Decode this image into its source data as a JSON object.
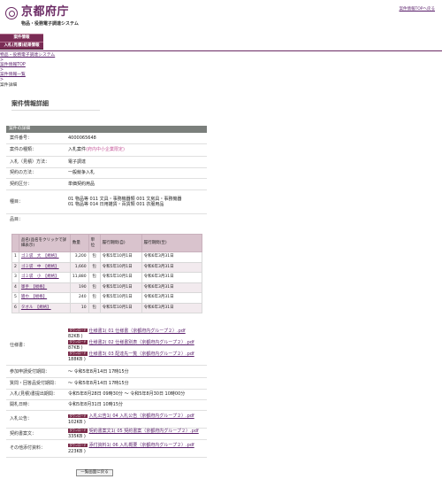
{
  "header": {
    "logo_title": "京都府庁",
    "logo_sub": "物品・役務電子調達システム",
    "help_link": "案件情報TOPへ戻る"
  },
  "nav": {
    "items": [
      "案件情報",
      "入札(見積)結果情報"
    ]
  },
  "breadcrumb": {
    "items": [
      "物品・役務電子調達システム",
      "案件情報TOP",
      "案件情報一覧"
    ],
    "separator": ">",
    "current": "案件詳細"
  },
  "page_title": "案件情報詳細",
  "section_title": "案件の詳細",
  "fields": {
    "case_no": {
      "label": "案件番号：",
      "value": "4000065648"
    },
    "case_type": {
      "label": "案件の種類：",
      "value": "入札案件",
      "note": "(府内中小企業限定)"
    },
    "bid_method": {
      "label": "入札（見積）方法：",
      "value": "電子調達"
    },
    "contract_method": {
      "label": "契約の方法：",
      "value": "一般競争入札"
    },
    "contract_class": {
      "label": "契約区分：",
      "value": "単価契約用品"
    },
    "category": {
      "label": "種目：",
      "lines": [
        "01 物品等 011 文具・事務機器類 001 文房具・事務機器",
        "01 物品等 014 日用雑貨・百貨類 001 衣服用品"
      ]
    },
    "items_label": "品目："
  },
  "items_table": {
    "headers": [
      "",
      "品名(品名をクリックで詳細表示)",
      "数量",
      "単位",
      "履行期間(自)",
      "履行期間(至)"
    ],
    "rows": [
      [
        "1",
        "ゴミ袋　大　【規格】",
        "3,200",
        "包",
        "令和5年10月1日",
        "令和6年3月31日"
      ],
      [
        "2",
        "ゴミ袋　中　【規格】",
        "1,660",
        "包",
        "令和5年10月1日",
        "令和6年3月31日"
      ],
      [
        "3",
        "ゴミ袋　小　【規格】",
        "11,880",
        "包",
        "令和5年10月1日",
        "令和6年3月31日"
      ],
      [
        "4",
        "軍手　【規格】",
        "190",
        "包",
        "令和5年10月1日",
        "令和6年3月31日"
      ],
      [
        "5",
        "雑巾　【規格】",
        "240",
        "包",
        "令和5年10月1日",
        "令和6年3月31日"
      ],
      [
        "6",
        "タオル　【規格】",
        "10",
        "包",
        "令和5年10月1日",
        "令和6年3月31日"
      ]
    ]
  },
  "download_badge": "ダウンロード",
  "spec": {
    "label": "仕様書：",
    "docs": [
      {
        "name": "仕様書1( 01 仕様書（京都府内グループ２）.pdf",
        "size": "82KB )"
      },
      {
        "name": "仕様書2( 02 仕様書別表（京都府内グループ２）.pdf",
        "size": "87KB )"
      },
      {
        "name": "仕様書3( 03 配達先一覧（京都府内グループ２）.pdf",
        "size": "188KB )"
      }
    ]
  },
  "schedule": {
    "participation": {
      "label": "参加申請受付期間：",
      "value": "～ 令和5年8月14日 17時15分"
    },
    "questions": {
      "label": "質問・回答品受付期間：",
      "value": "～ 令和5年8月14日 17時15分"
    },
    "bid_period": {
      "label": "入札(見積)書提出期間：",
      "value": "令和5年8月28日 09時30分 ～ 令和5年8月30日 10時00分"
    },
    "opening": {
      "label": "開札日時：",
      "value": "令和5年8月31日 10時15分"
    }
  },
  "notice": {
    "label": "入札公告：",
    "docs": [
      {
        "name": "入札公告1( 04 入札公告（京都府内グループ２）.pdf",
        "size": "102KB )"
      }
    ]
  },
  "contract_draft": {
    "label": "契約書案文：",
    "docs": [
      {
        "name": "契約書案文1( 05 契約書案（京都府内グループ２）.pdf",
        "size": "335KB )"
      }
    ]
  },
  "other": {
    "label": "その他添付資料：",
    "docs": [
      {
        "name": "添付資料1( 06 入札概要（京都府内グループ２）.pdf",
        "size": "223KB )"
      }
    ]
  },
  "back_button": "一覧画面に戻る"
}
